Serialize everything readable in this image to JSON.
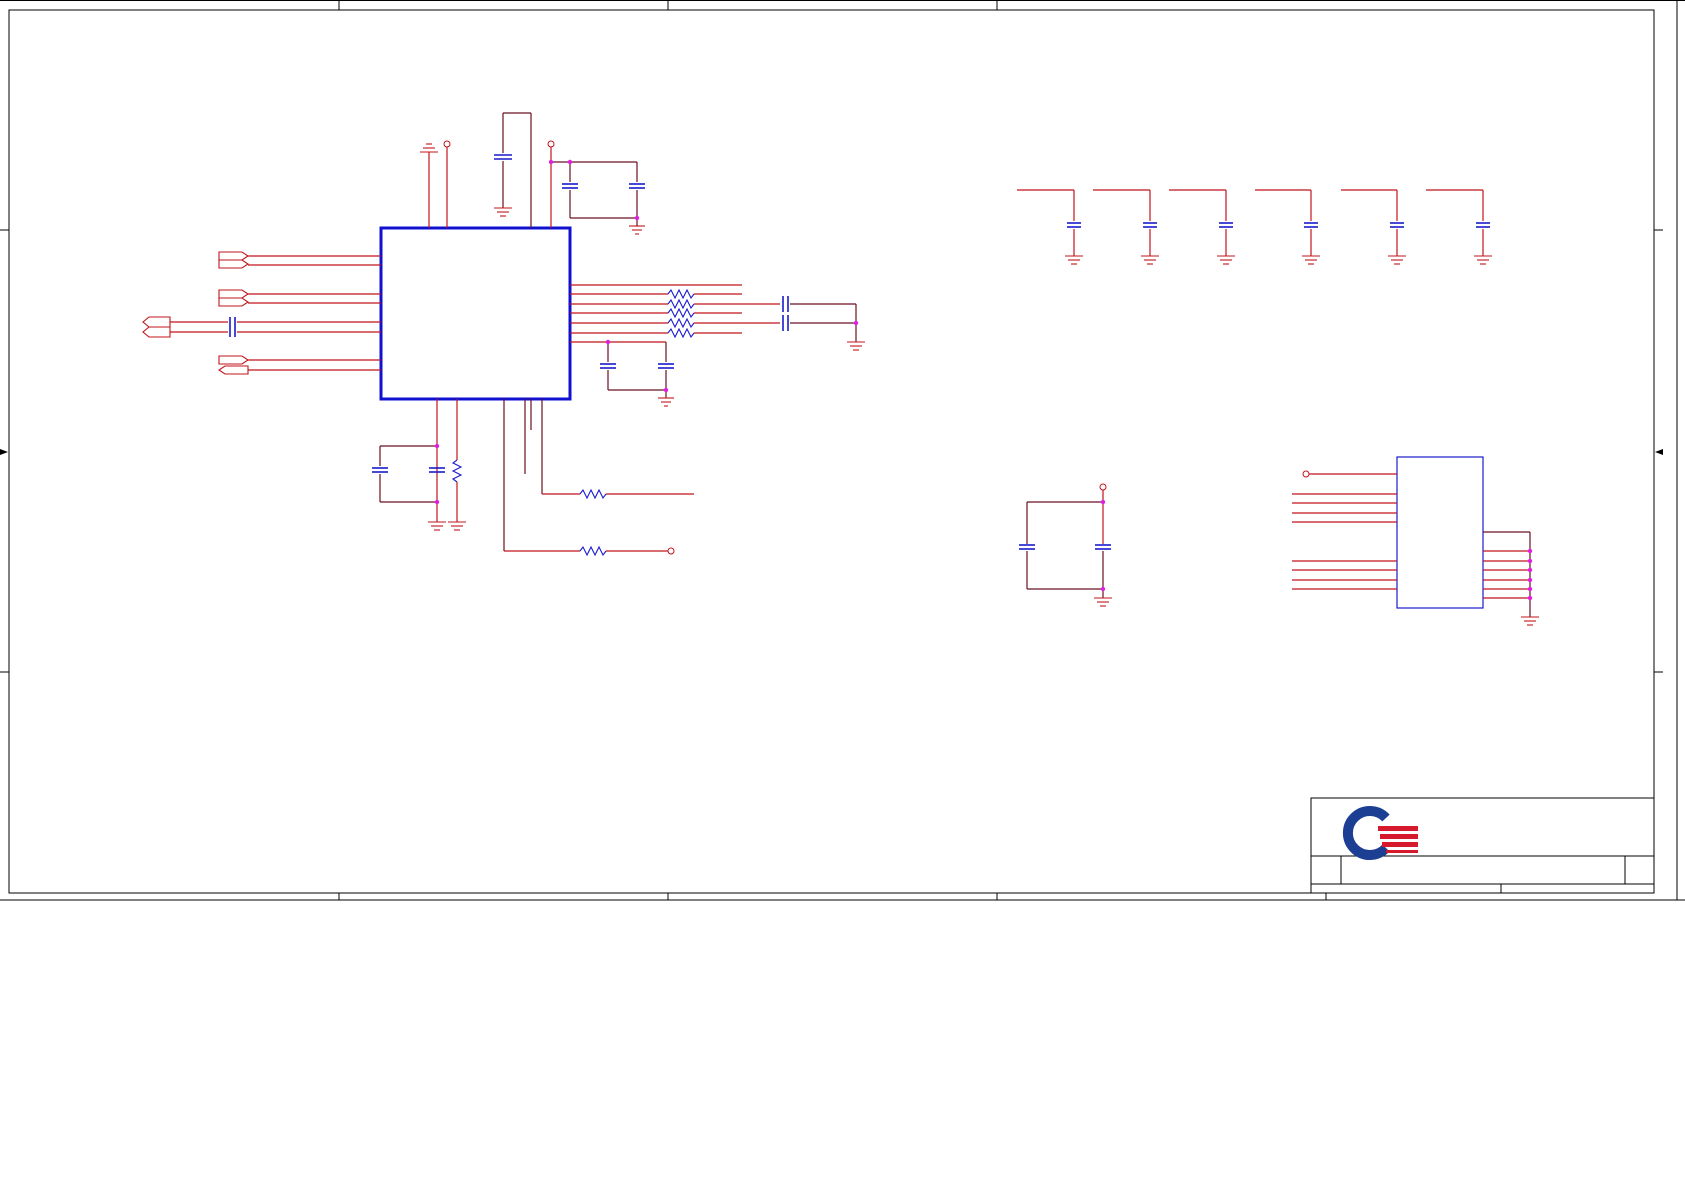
{
  "sheet": {
    "logo": "company-logo"
  },
  "title_block": {
    "logo_icon": "q-logo-icon",
    "colors": {
      "logo_blue": "#1c3f94",
      "logo_red": "#d7192e"
    }
  },
  "colors": {
    "wire": "#c0141c",
    "component": "#1a1acc",
    "junction": "#e020e0",
    "frame": "#000000"
  }
}
